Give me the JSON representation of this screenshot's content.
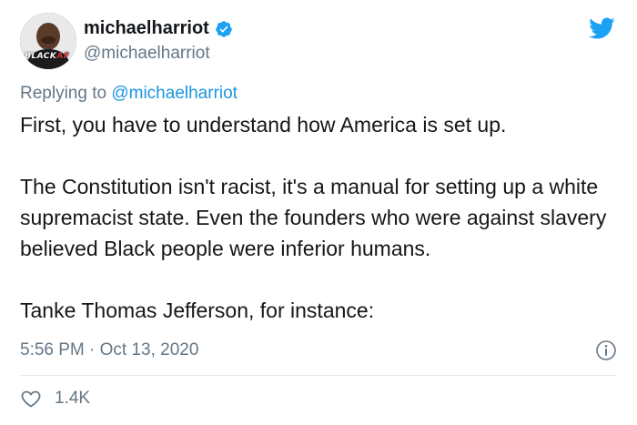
{
  "author": {
    "display_name": "michaelharriot",
    "handle": "@michaelharriot",
    "avatar_badge": {
      "main": "BLACK",
      "suffix": "AF"
    },
    "verified_icon": "verified-badge-icon"
  },
  "reply_context": {
    "prefix": "Replying to",
    "target": "@michaelharriot"
  },
  "body": {
    "paragraphs": [
      "First, you have to understand how America is set up.",
      "The Constitution isn't racist, it's a manual for setting up a white supremacist state. Even the founders who were against slavery believed Black people were inferior humans.",
      "Tanke Thomas Jefferson, for instance:"
    ]
  },
  "meta": {
    "timestamp": "5:56 PM · Oct 13, 2020"
  },
  "actions": {
    "like_count": "1.4K"
  },
  "icons": {
    "brand": "twitter-bird-icon",
    "info": "info-icon",
    "like": "heart-icon"
  },
  "colors": {
    "brand_blue": "#1da1f2",
    "link_blue": "#1b95e0",
    "muted_gray": "#657786",
    "text_dark": "#14171a"
  }
}
